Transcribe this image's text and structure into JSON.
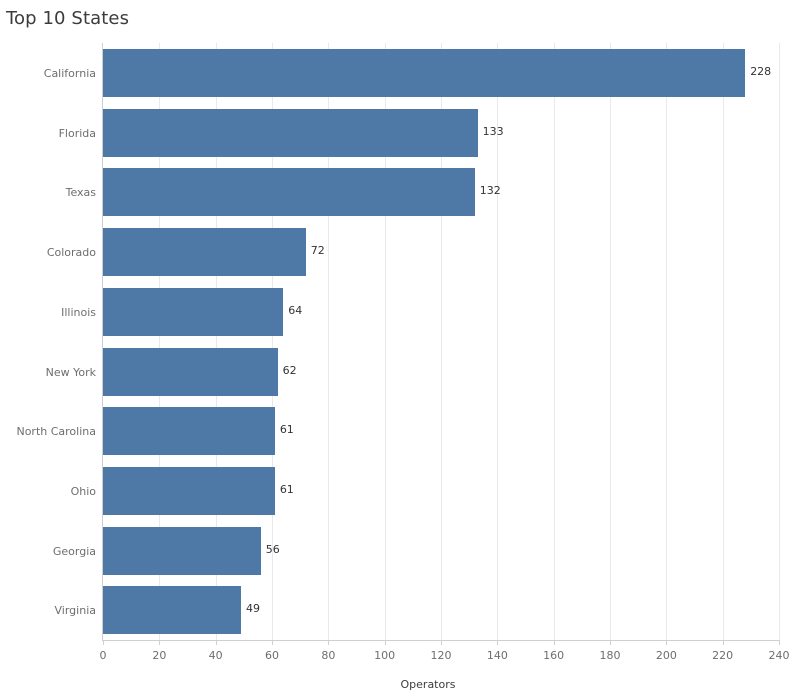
{
  "chart_data": {
    "type": "bar",
    "orientation": "horizontal",
    "title": "Top 10 States",
    "xlabel": "Operators",
    "ylabel": "",
    "categories": [
      "California",
      "Florida",
      "Texas",
      "Colorado",
      "Illinois",
      "New York",
      "North Carolina",
      "Ohio",
      "Georgia",
      "Virginia"
    ],
    "values": [
      228,
      133,
      132,
      72,
      64,
      62,
      61,
      61,
      56,
      49
    ],
    "value_labels": [
      "228",
      "133",
      "132",
      "72",
      "64",
      "62",
      "61",
      "61",
      "56",
      "49"
    ],
    "xlim": [
      0,
      240
    ],
    "xticks": [
      0,
      20,
      40,
      60,
      80,
      100,
      120,
      140,
      160,
      180,
      200,
      220,
      240
    ],
    "xtick_labels": [
      "0",
      "20",
      "40",
      "60",
      "80",
      "100",
      "120",
      "140",
      "160",
      "180",
      "200",
      "220",
      "240"
    ],
    "grid": true,
    "grid_axis": "x",
    "legend": false,
    "bar_color": "#4e79a7",
    "gridline_color": "#e9e9e9",
    "axis_color": "#cfcfcf",
    "label_color": "#6e6e6e",
    "value_label_color": "#333333",
    "title_color": "#3c3c3c",
    "background": "#ffffff"
  }
}
